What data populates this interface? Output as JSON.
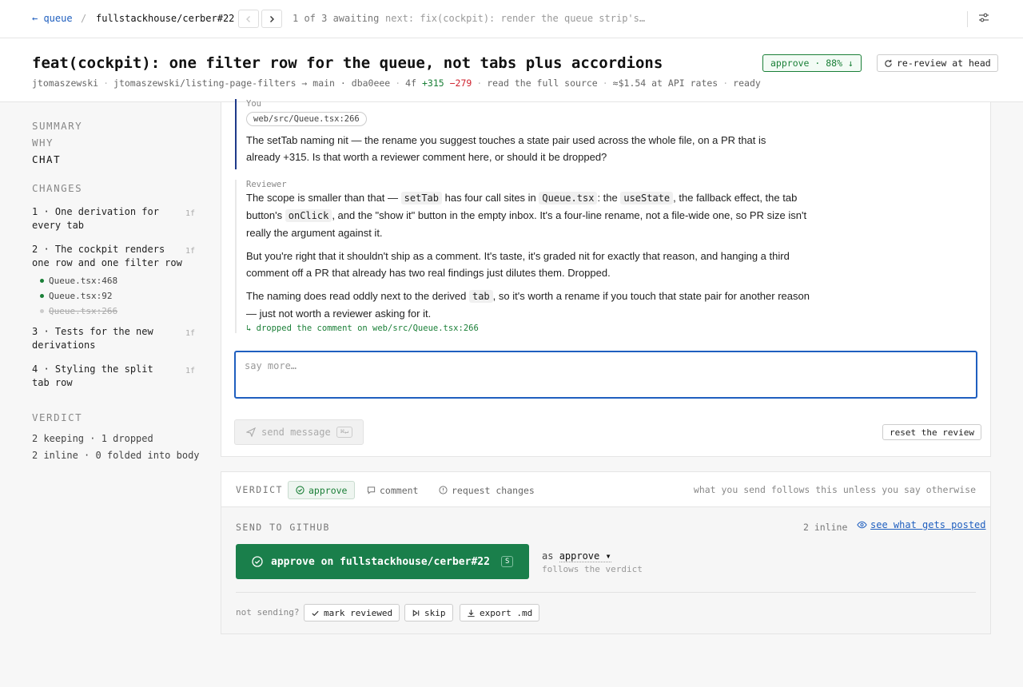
{
  "topbar": {
    "back": "← queue",
    "separator": "/",
    "repo": "fullstackhouse/cerber#22",
    "count": "1 of 3 awaiting",
    "next": "next: fix(cockpit): render the queue strip's…"
  },
  "header": {
    "title": "feat(cockpit): one filter row for the queue, not tabs plus accordions",
    "author": "jtomaszewski",
    "branch": "jtomaszewski/listing-page-filters → main",
    "commit": "dba0eee",
    "files": "4f",
    "additions": "+315",
    "deletions": "−279",
    "source_link": "read the full source",
    "cost": "≈$1.54 at API rates",
    "status": "ready",
    "approve_badge": "approve · 88% ↓",
    "rereview": "re-review at head"
  },
  "sidebar": {
    "nav": [
      "SUMMARY",
      "WHY",
      "CHAT"
    ],
    "changes_title": "CHANGES",
    "changes": [
      {
        "label": "1 · One derivation for every tab",
        "files": "1f"
      },
      {
        "label": "2 · The cockpit renders one row and one filter row",
        "files": "1f"
      },
      {
        "label": "3 · Tests for the new derivations",
        "files": "1f"
      },
      {
        "label": "4 · Styling the split tab row",
        "files": "1f"
      }
    ],
    "subitems": [
      "Queue.tsx:468",
      "Queue.tsx:92",
      "Queue.tsx:266"
    ],
    "verdict_title": "VERDICT",
    "verdict_lines": [
      "2 keeping · 1 dropped",
      "2 inline · 0 folded into body"
    ]
  },
  "chat": {
    "you_label": "You",
    "you_file": "web/src/Queue.tsx:266",
    "you_text": "The setTab naming nit — the rename you suggest touches a state pair used across the whole file, on a PR that is already +315. Is that worth a reviewer comment here, or should it be dropped?",
    "reviewer_label": "Reviewer",
    "r1_a": "The scope is smaller than that — ",
    "r1_code1": "setTab",
    "r1_b": " has four call sites in ",
    "r1_code2": "Queue.tsx",
    "r1_c": ": the ",
    "r1_code3": "useState",
    "r1_d": ", the fallback effect, the tab button's ",
    "r1_code4": "onClick",
    "r1_e": ", and the \"show it\" button in the empty inbox. It's a four-line rename, not a file-wide one, so PR size isn't really the argument against it.",
    "r2": "But you're right that it shouldn't ship as a comment. It's taste, it's graded nit for exactly that reason, and hanging a third comment off a PR that already has two real findings just dilutes them. Dropped.",
    "r3_a": "The naming does read oddly next to the derived ",
    "r3_code": "tab",
    "r3_b": ", so it's worth a rename if you touch that state pair for another reason — just not worth a reviewer asking for it.",
    "dropped": "↳ dropped the comment on web/src/Queue.tsx:266",
    "placeholder": "say more…",
    "send": "send message",
    "send_kbd": "⌘↵",
    "reset": "reset the review"
  },
  "verdict": {
    "label": "VERDICT",
    "options": [
      "approve",
      "comment",
      "request changes"
    ],
    "hint": "what you send follows this unless you say otherwise"
  },
  "send": {
    "label": "SEND TO GITHUB",
    "inline": "2 inline",
    "see": "see what gets posted",
    "button": "approve on fullstackhouse/cerber#22",
    "button_kbd": "S",
    "as": "as",
    "as_value": "approve ▾",
    "follows": "follows the verdict",
    "not_sending": "not sending?",
    "mark": "mark reviewed",
    "skip": "skip",
    "export": "export .md"
  },
  "colors": {
    "accent": "#1f5fbf",
    "approve": "#1a7f37",
    "button": "#1a7f4b"
  }
}
